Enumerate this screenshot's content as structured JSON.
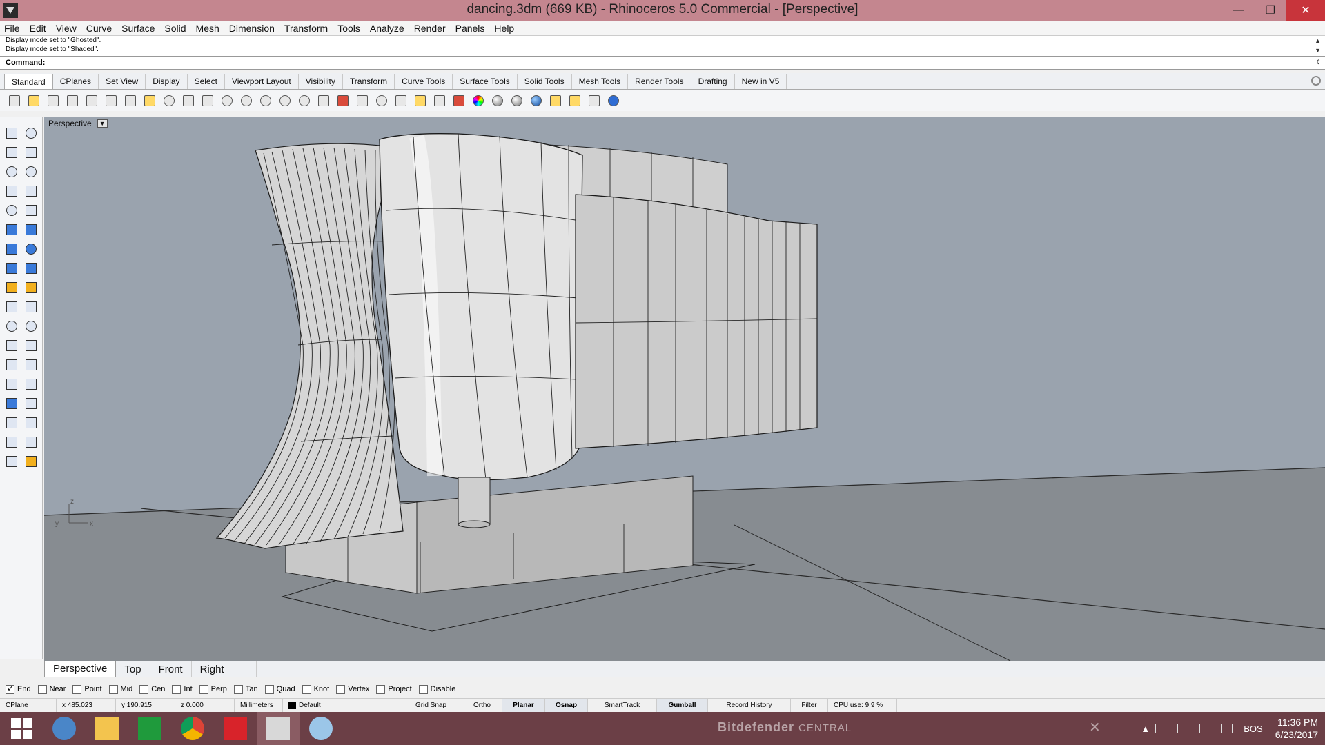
{
  "window": {
    "title": "dancing.3dm (669 KB) - Rhinoceros 5.0 Commercial - [Perspective]",
    "minimize": "—",
    "restore": "❐",
    "close": "✕"
  },
  "menu": [
    "File",
    "Edit",
    "View",
    "Curve",
    "Surface",
    "Solid",
    "Mesh",
    "Dimension",
    "Transform",
    "Tools",
    "Analyze",
    "Render",
    "Panels",
    "Help"
  ],
  "command": {
    "history": [
      "Display mode set to \"Ghosted\".",
      "Display mode set to \"Shaded\"."
    ],
    "prompt": "Command:"
  },
  "toolbar_tabs": [
    "Standard",
    "CPlanes",
    "Set View",
    "Display",
    "Select",
    "Viewport Layout",
    "Visibility",
    "Transform",
    "Curve Tools",
    "Surface Tools",
    "Solid Tools",
    "Mesh Tools",
    "Render Tools",
    "Drafting",
    "New in V5"
  ],
  "viewport": {
    "label": "Perspective",
    "axis_z": "z",
    "axis_y": "y",
    "axis_x": "x"
  },
  "viewport_tabs": [
    "Perspective",
    "Top",
    "Front",
    "Right"
  ],
  "osnaps": [
    {
      "label": "End",
      "checked": true
    },
    {
      "label": "Near",
      "checked": false
    },
    {
      "label": "Point",
      "checked": false
    },
    {
      "label": "Mid",
      "checked": false
    },
    {
      "label": "Cen",
      "checked": false
    },
    {
      "label": "Int",
      "checked": false
    },
    {
      "label": "Perp",
      "checked": false
    },
    {
      "label": "Tan",
      "checked": false
    },
    {
      "label": "Quad",
      "checked": false
    },
    {
      "label": "Knot",
      "checked": false
    },
    {
      "label": "Vertex",
      "checked": false
    },
    {
      "label": "Project",
      "checked": false
    },
    {
      "label": "Disable",
      "checked": false
    }
  ],
  "status": {
    "cplane": "CPlane",
    "x": "x 485.023",
    "y": "y 190.915",
    "z": "z 0.000",
    "units": "Millimeters",
    "layer": "Default",
    "grid_snap": "Grid Snap",
    "ortho": "Ortho",
    "planar": "Planar",
    "osnap": "Osnap",
    "smarttrack": "SmartTrack",
    "gumball": "Gumball",
    "record_history": "Record History",
    "filter": "Filter",
    "cpu": "CPU use: 9.9 %"
  },
  "taskbar": {
    "notification_brand": "Bitdefender",
    "notification_sub": "CENTRAL",
    "language": "BOS",
    "time": "11:36 PM",
    "date": "6/23/2017"
  }
}
